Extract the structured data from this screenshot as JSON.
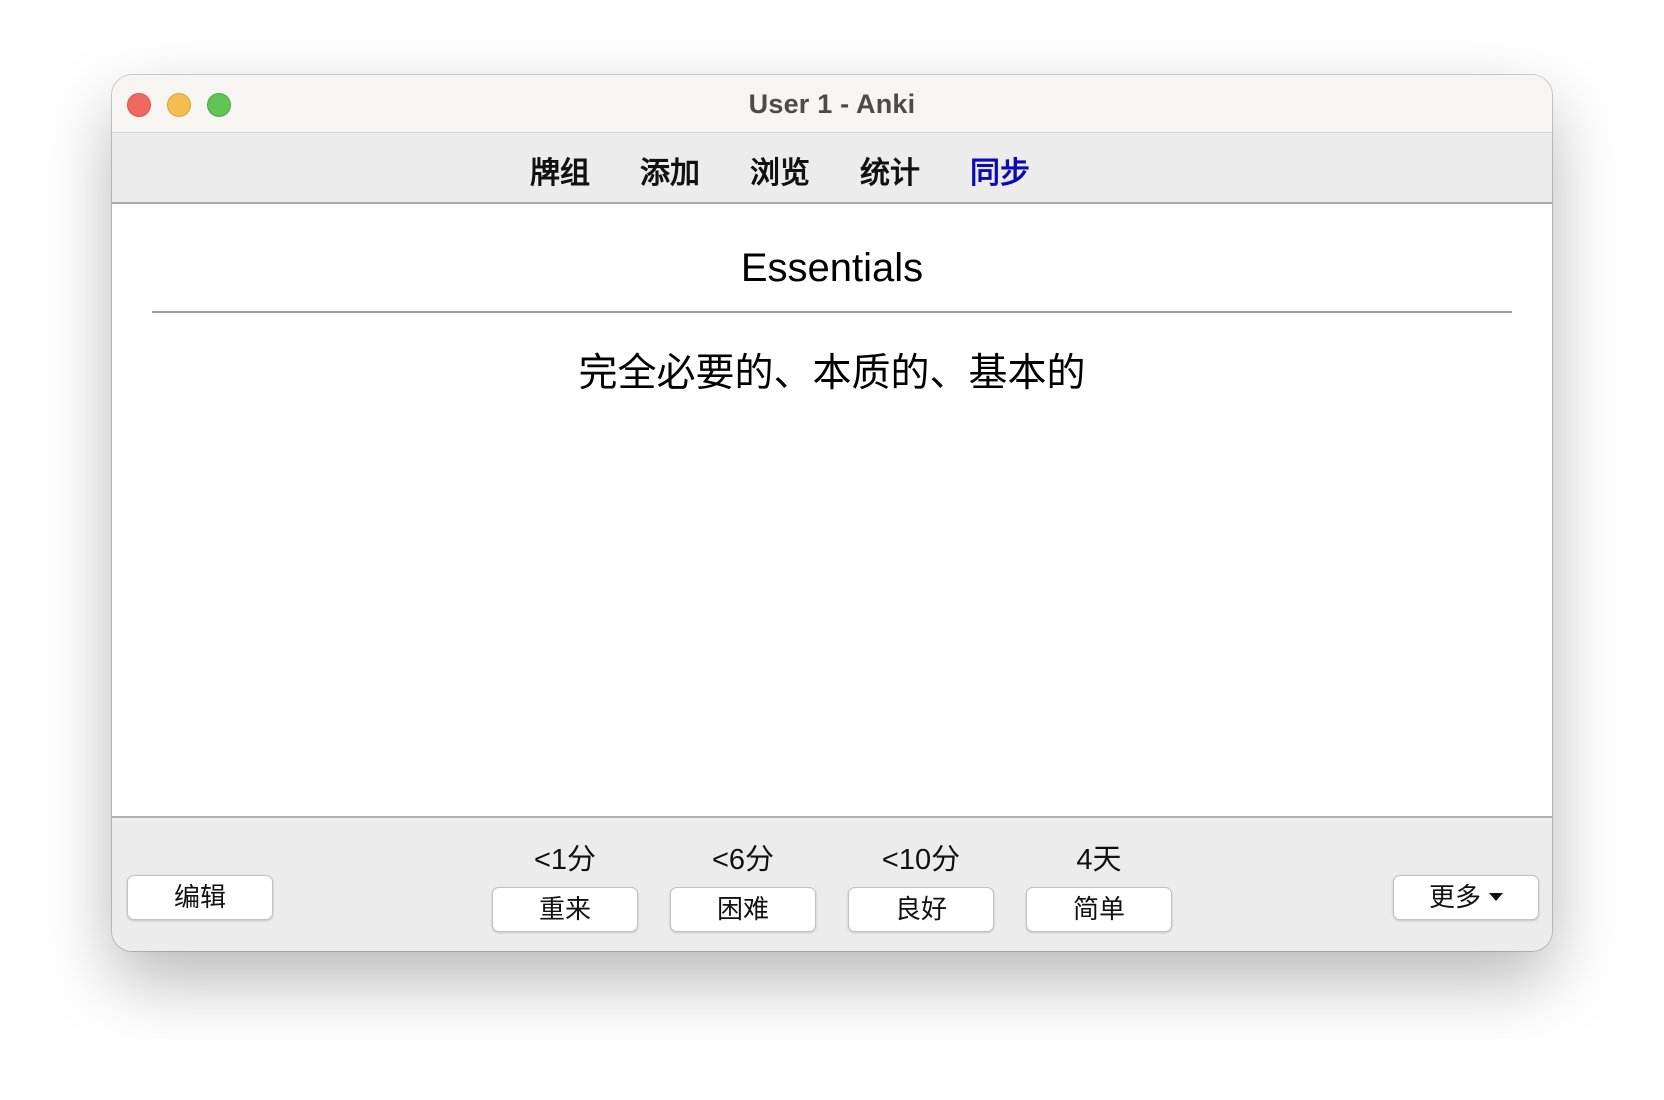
{
  "window": {
    "title": "User 1 - Anki"
  },
  "toolbar": {
    "items": [
      {
        "label": "牌组"
      },
      {
        "label": "添加"
      },
      {
        "label": "浏览"
      },
      {
        "label": "统计"
      },
      {
        "label": "同步",
        "active": true
      }
    ],
    "active_color": "#0b0bb0"
  },
  "card": {
    "front": "Essentials",
    "back": "完全必要的、本质的、基本的"
  },
  "bottom": {
    "edit_label": "编辑",
    "more_label": "更多",
    "answers": [
      {
        "interval": "<1分",
        "label": "重来"
      },
      {
        "interval": "<6分",
        "label": "困难"
      },
      {
        "interval": "<10分",
        "label": "良好"
      },
      {
        "interval": "4天",
        "label": "简单"
      }
    ]
  }
}
